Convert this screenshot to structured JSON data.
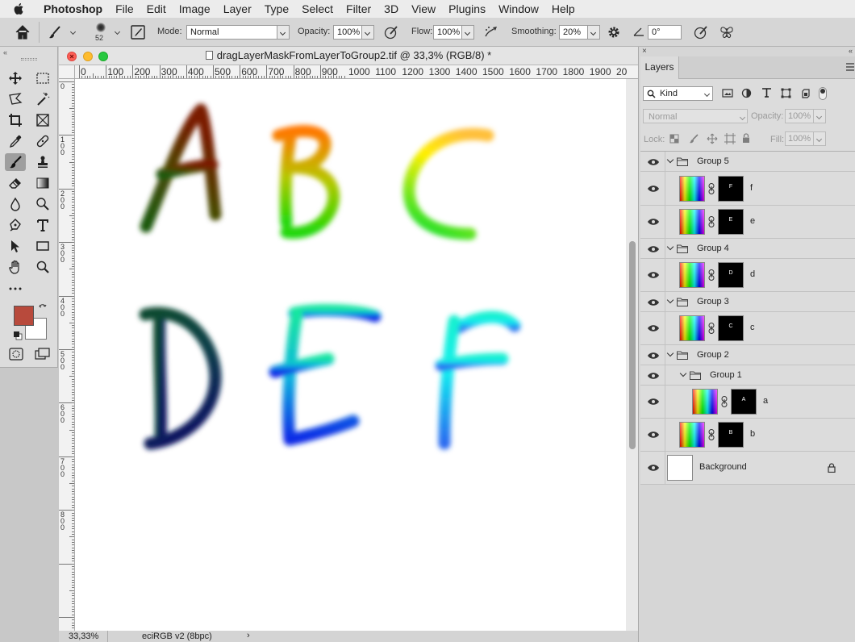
{
  "menubar": {
    "app_name": "Photoshop",
    "items": [
      "File",
      "Edit",
      "Image",
      "Layer",
      "Type",
      "Select",
      "Filter",
      "3D",
      "View",
      "Plugins",
      "Window",
      "Help"
    ]
  },
  "options": {
    "brush_size": "52",
    "mode_label": "Mode:",
    "mode_value": "Normal",
    "opacity_label": "Opacity:",
    "opacity_value": "100%",
    "flow_label": "Flow:",
    "flow_value": "100%",
    "smoothing_label": "Smoothing:",
    "smoothing_value": "20%",
    "angle_value": "0°"
  },
  "tools": {
    "foreground_color": "#b84a3c",
    "background_color": "#ffffff"
  },
  "document": {
    "title": "dragLayerMaskFromLayerToGroup2.tif @ 33,3% (RGB/8) *",
    "zoom": "33,33%",
    "color_profile": "eciRGB v2 (8bpc)",
    "ruler_h": [
      "0",
      "100",
      "200",
      "300",
      "400",
      "500",
      "600",
      "700",
      "800",
      "900",
      "1000",
      "1100",
      "1200",
      "1300",
      "1400",
      "1500",
      "1600",
      "1700",
      "1800",
      "1900",
      "20"
    ],
    "ruler_v": [
      "0",
      "100",
      "200",
      "300",
      "400",
      "500",
      "600",
      "700",
      "800"
    ],
    "letters": [
      "A",
      "B",
      "C",
      "D",
      "E",
      "F"
    ]
  },
  "layers_panel": {
    "tab": "Layers",
    "filter_kind": "Kind",
    "blend_mode": "Normal",
    "opacity_label": "Opacity:",
    "opacity_value": "100%",
    "lock_label": "Lock:",
    "fill_label": "Fill:",
    "fill_value": "100%",
    "groups": {
      "g5": "Group 5",
      "g4": "Group 4",
      "g3": "Group 3",
      "g2": "Group 2",
      "g1": "Group 1"
    },
    "layers": {
      "f": "f",
      "e": "e",
      "d": "d",
      "c": "c",
      "a": "a",
      "b": "b",
      "background": "Background"
    },
    "mask_glyphs": {
      "f": "F",
      "e": "E",
      "d": "D",
      "c": "C",
      "a": "A",
      "b": "B"
    }
  }
}
